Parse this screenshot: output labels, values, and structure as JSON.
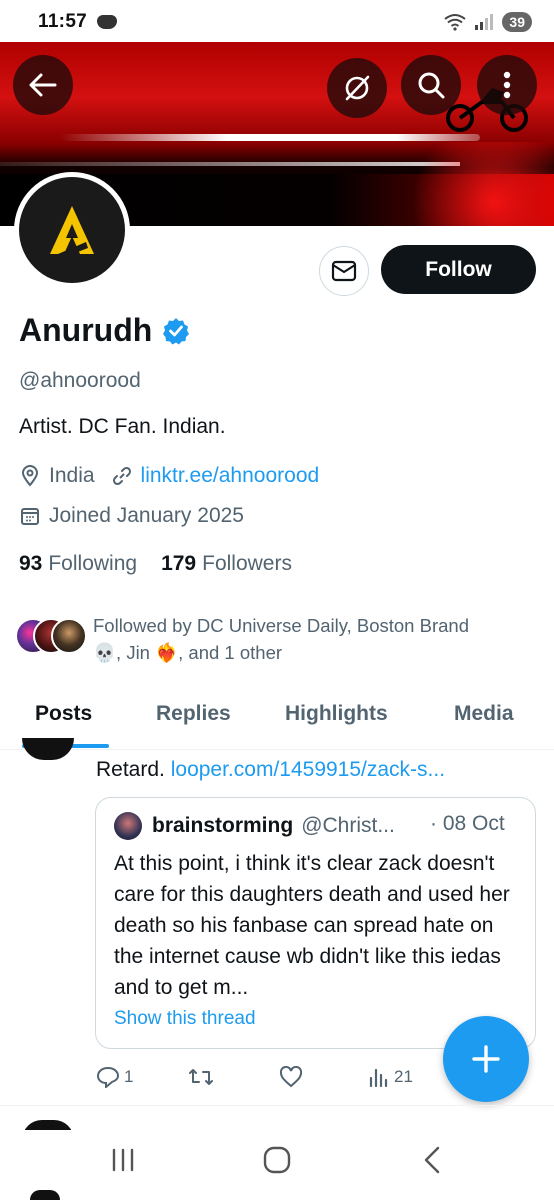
{
  "status_bar": {
    "time": "11:57",
    "battery": "39"
  },
  "header": {
    "back_icon": "arrow-left-icon",
    "grok_icon": "grok-icon",
    "search_icon": "search-icon",
    "more_icon": "more-vertical-icon"
  },
  "profile": {
    "name": "Anurudh",
    "handle": "@ahnoorood",
    "bio": "Artist. DC Fan. Indian.",
    "location": "India",
    "website": "linktr.ee/ahnoorood",
    "joined": "Joined January 2025",
    "following_count": "93",
    "following_label": "Following",
    "followers_count": "179",
    "followers_label": "Followers",
    "followed_by_line1": "Followed by DC Universe Daily, Boston Brand",
    "followed_by_line2_a": "💀, Jin ❤️‍🔥, and 1 other",
    "follow_label": "Follow",
    "verified_color": "#1d9bf0"
  },
  "tabs": [
    "Posts",
    "Replies",
    "Highlights",
    "Media"
  ],
  "tweet": {
    "text_prefix": "Retard.",
    "link": "looper.com/1459915/zack-s...",
    "quote": {
      "name": "brainstorming",
      "handle": "@Christ...",
      "date": "· 08 Oct",
      "body": "At this point, i think it's clear zack doesn't care for this daughters death and used her death so his fanbase can spread hate on the internet cause wb didn't like this iedas and to get m...",
      "show_thread": "Show this thread"
    },
    "replies": "1",
    "views": "21"
  },
  "colors": {
    "accent": "#1d9bf0",
    "text": "#0f1419",
    "muted": "#536471"
  }
}
